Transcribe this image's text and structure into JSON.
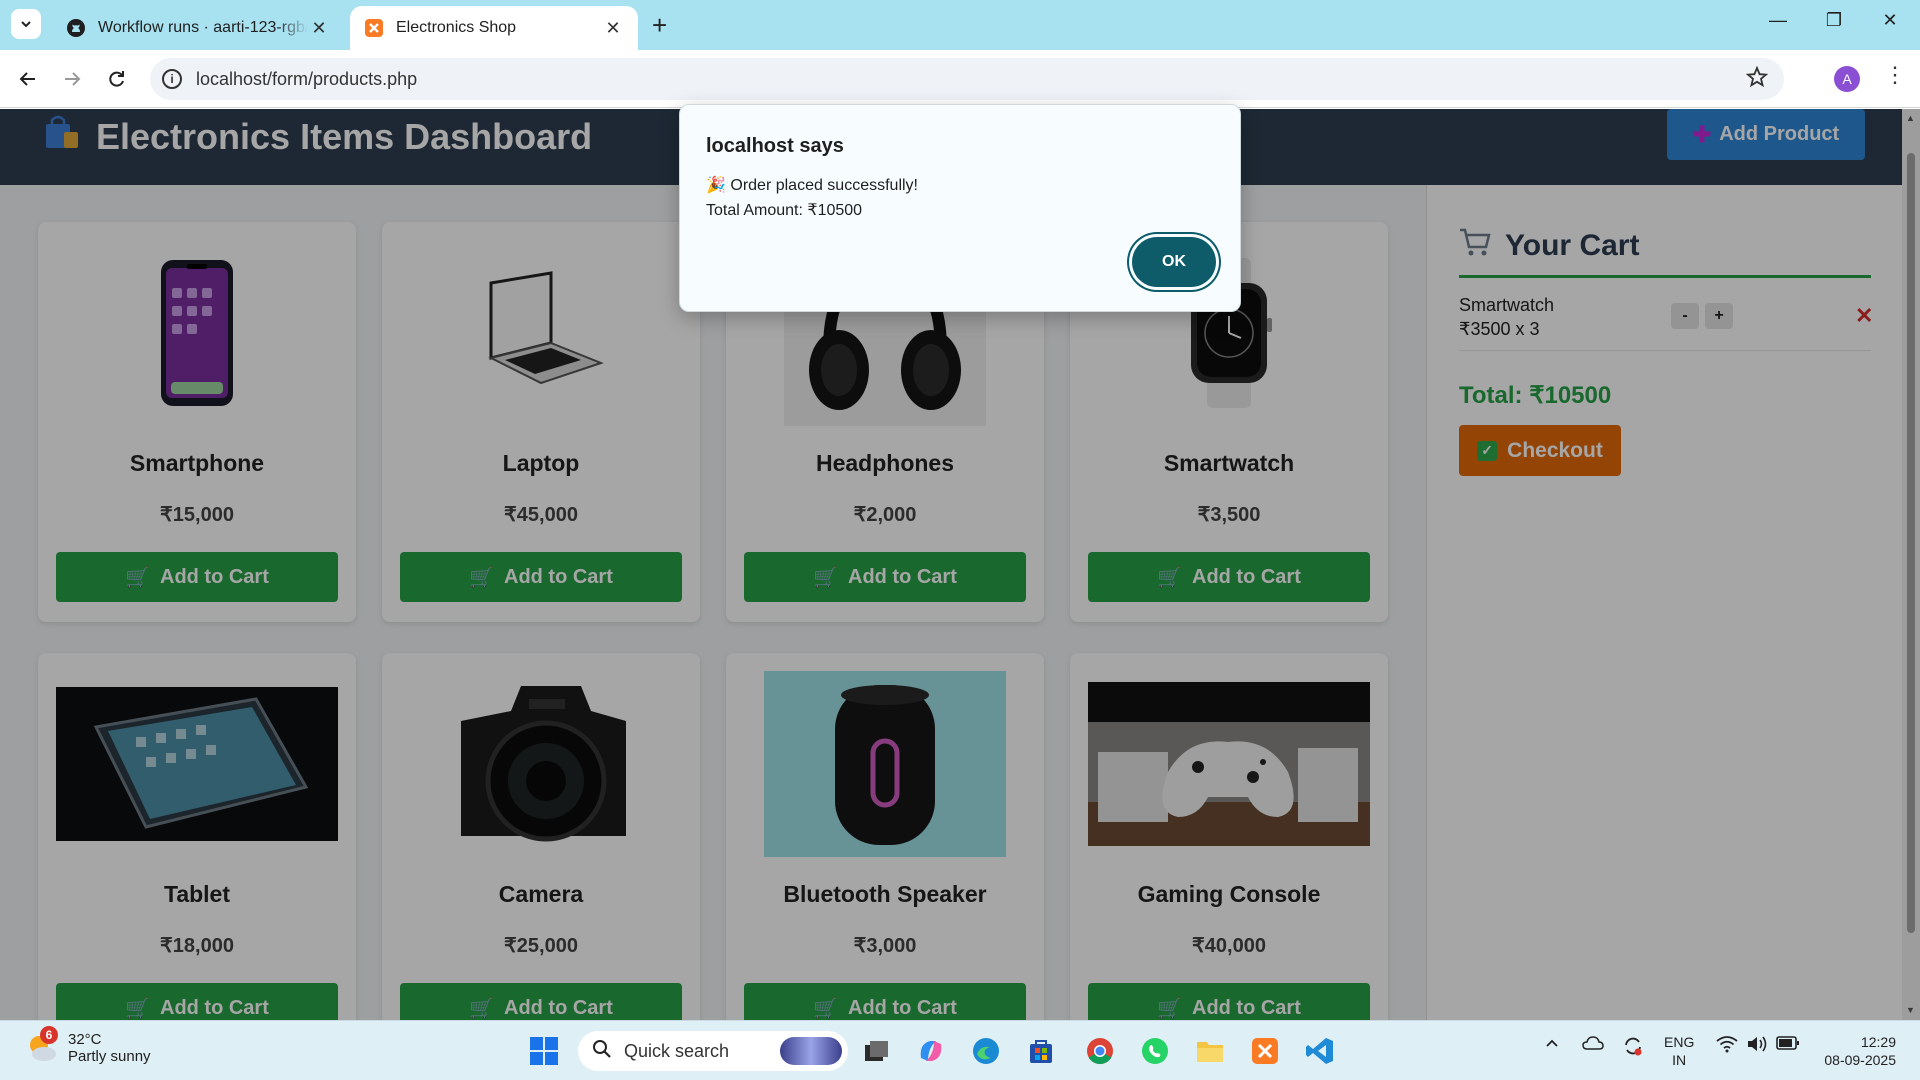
{
  "browser": {
    "tabs": [
      {
        "title": "Workflow runs · aarti-123-rgb/a",
        "active": false
      },
      {
        "title": "Electronics Shop",
        "active": true
      }
    ],
    "url": "localhost/form/products.php",
    "profile_initial": "A"
  },
  "header": {
    "title": "Electronics Items Dashboard",
    "add_product_label": "Add Product"
  },
  "products": [
    {
      "name": "Smartphone",
      "price": "₹15,000",
      "button": "Add to Cart"
    },
    {
      "name": "Laptop",
      "price": "₹45,000",
      "button": "Add to Cart"
    },
    {
      "name": "Headphones",
      "price": "₹2,000",
      "button": "Add to Cart"
    },
    {
      "name": "Smartwatch",
      "price": "₹3,500",
      "button": "Add to Cart"
    },
    {
      "name": "Tablet",
      "price": "₹18,000",
      "button": "Add to Cart"
    },
    {
      "name": "Camera",
      "price": "₹25,000",
      "button": "Add to Cart"
    },
    {
      "name": "Bluetooth Speaker",
      "price": "₹3,000",
      "button": "Add to Cart"
    },
    {
      "name": "Gaming Console",
      "price": "₹40,000",
      "button": "Add to Cart"
    }
  ],
  "cart": {
    "title": "Your Cart",
    "items": [
      {
        "name": "Smartwatch",
        "price_qty": "₹3500 x 3",
        "minus": "-",
        "plus": "+",
        "remove": "✕"
      }
    ],
    "total": "Total: ₹10500",
    "checkout_label": "Checkout"
  },
  "dialog": {
    "title": "localhost says",
    "message_line1": "🎉 Order placed successfully!",
    "message_line2": "Total Amount: ₹10500",
    "ok_label": "OK"
  },
  "taskbar": {
    "weather_badge": "6",
    "temperature": "32°C",
    "condition": "Partly sunny",
    "search_label": "Quick search",
    "language": "ENG",
    "region": "IN",
    "time": "12:29",
    "date": "08-09-2025"
  },
  "colors": {
    "header_bg": "#2d3e50",
    "add_to_cart": "#27a046",
    "checkout": "#e46a0a",
    "add_product": "#2f86d6",
    "dialog_ok": "#0e5c6a",
    "tabstrip": "#a8e1f0"
  }
}
